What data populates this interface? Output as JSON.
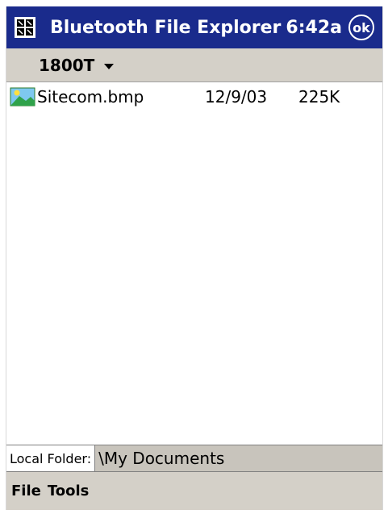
{
  "window": {
    "title": "Bluetooth File Explorer",
    "clock": "6:42a",
    "ok_label": "ok"
  },
  "device": {
    "selected": "1800T"
  },
  "files": [
    {
      "name": "Sitecom.bmp",
      "date": "12/9/03",
      "size": "225K",
      "icon": "bitmap-file-icon"
    }
  ],
  "path": {
    "tab_label": "Local Folder:",
    "value": "\\My Documents"
  },
  "menu": {
    "file_label": "File",
    "tools_label": "Tools"
  }
}
